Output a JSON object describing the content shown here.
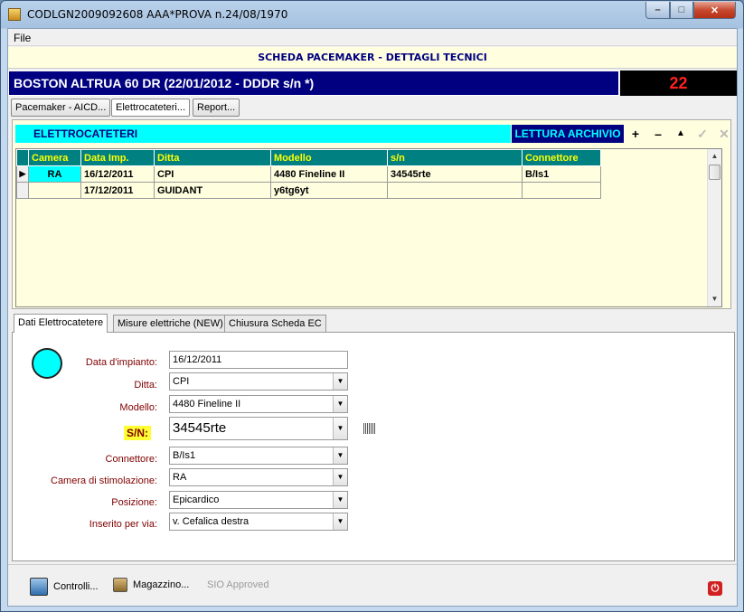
{
  "window": {
    "title": "CODLGN2009092608 AAA*PROVA n.24/08/1970"
  },
  "menu": {
    "file": "File"
  },
  "header": {
    "title": "SCHEDA PACEMAKER - DETTAGLI TECNICI"
  },
  "device": {
    "label": "BOSTON ALTRUA 60 DR (22/01/2012 - DDDR s/n *)",
    "counter": "22"
  },
  "toptabs": [
    "Pacemaker - AICD...",
    "Elettrocateteri...",
    "Report..."
  ],
  "section": {
    "title": "ELETTROCATETERI",
    "archive": "LETTURA ARCHIVIO"
  },
  "grid": {
    "columns": [
      "Camera",
      "Data Imp.",
      "Ditta",
      "Modello",
      "s/n",
      "Connettore"
    ],
    "rows": [
      [
        "RA",
        "16/12/2011",
        "CPI",
        "4480 Fineline II",
        "34545rte",
        "B/Is1"
      ],
      [
        "",
        "17/12/2011",
        "GUIDANT",
        "y6tg6yt",
        "",
        ""
      ]
    ]
  },
  "tabs": [
    "Dati Elettrocatetere",
    "Misure elettriche (NEW)",
    "Chiusura Scheda EC"
  ],
  "form": {
    "data_impianto_label": "Data d'impianto:",
    "data_impianto": "16/12/2011",
    "ditta_label": "Ditta:",
    "ditta": "CPI",
    "modello_label": "Modello:",
    "modello": "4480 Fineline II",
    "sn_label": "S/N:",
    "sn": "34545rte",
    "connettore_label": "Connettore:",
    "connettore": "B/Is1",
    "camera_label": "Camera di stimolazione:",
    "camera": "RA",
    "posizione_label": "Posizione:",
    "posizione": "Epicardico",
    "via_label": "Inserito per via:",
    "via": "v. Cefalica destra"
  },
  "bottom": {
    "controlli": "Controlli...",
    "magazzino": "Magazzino...",
    "sio": "SIO Approved"
  },
  "colors": {
    "navy": "#000080",
    "cyan": "#00ffff",
    "teal": "#008080",
    "yellow": "#ffff00",
    "counter": "#ff2020"
  }
}
